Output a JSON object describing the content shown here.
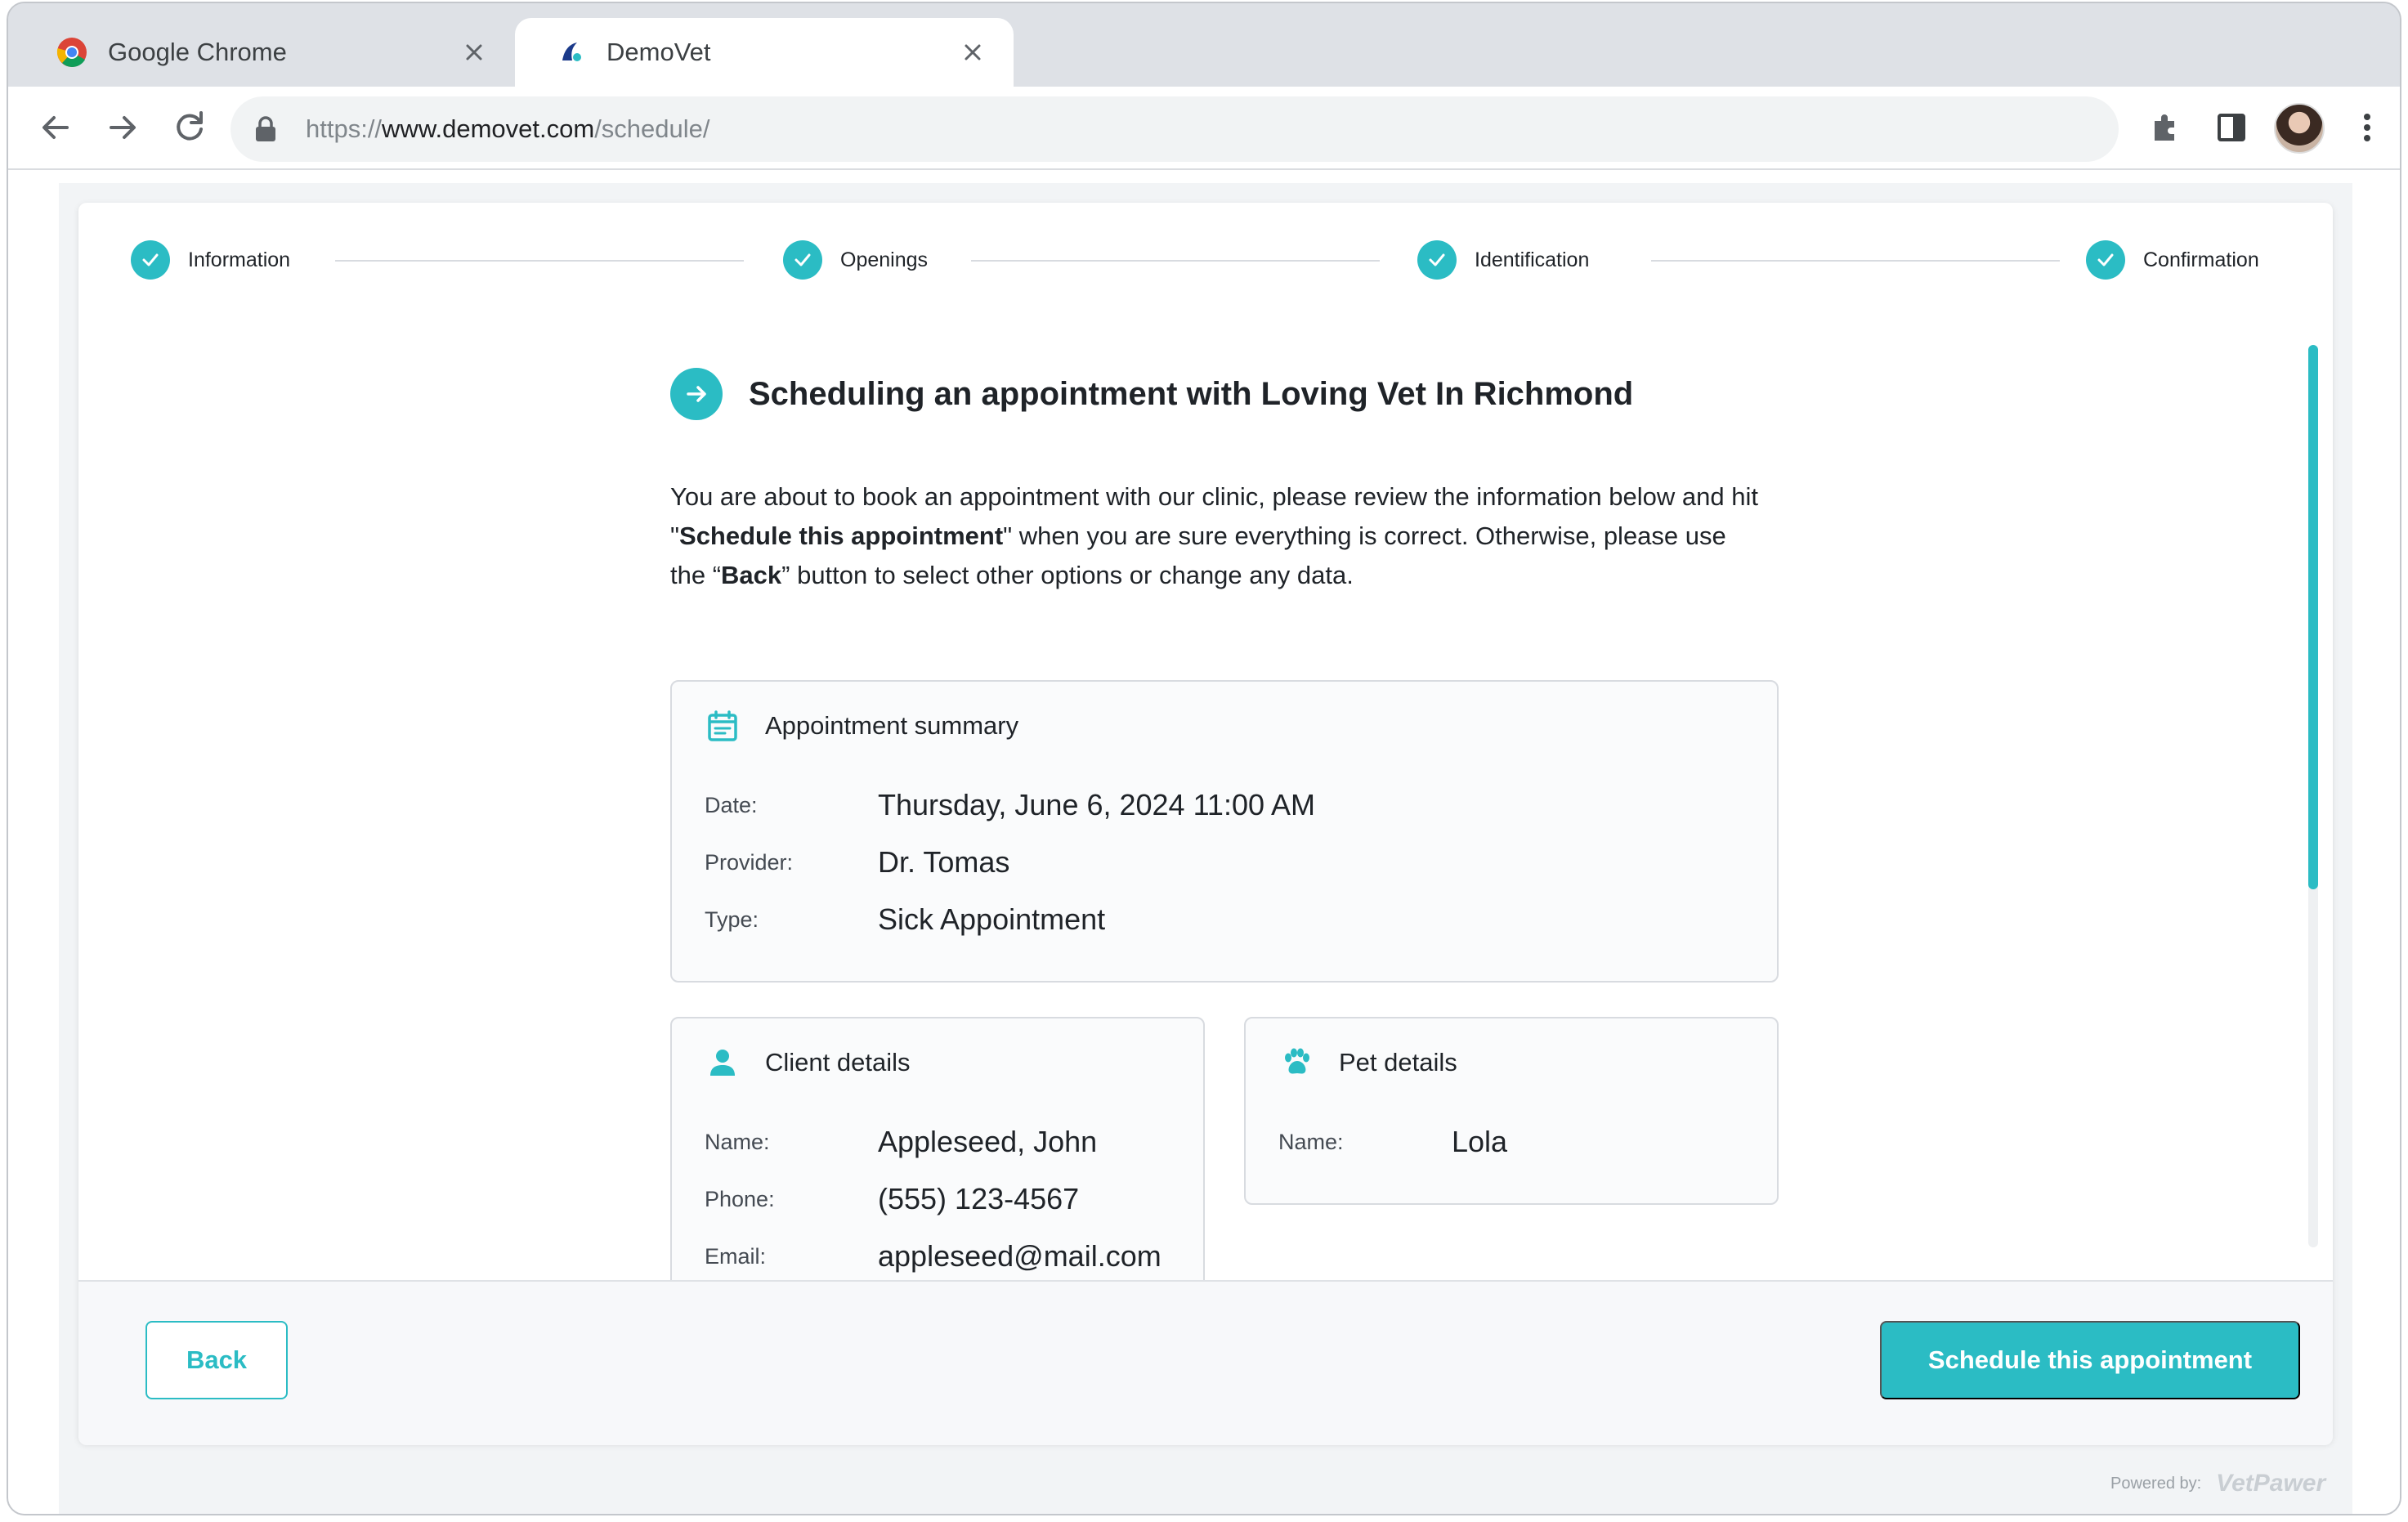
{
  "browser": {
    "tabs": [
      {
        "title": "Google Chrome",
        "active": false
      },
      {
        "title": "DemoVet",
        "active": true
      }
    ],
    "url": {
      "scheme": "https://",
      "host": "www.demovet.com",
      "path": "/schedule/"
    }
  },
  "stepper": {
    "steps": [
      {
        "label": "Information",
        "status": "complete"
      },
      {
        "label": "Openings",
        "status": "complete"
      },
      {
        "label": "Identification",
        "status": "complete"
      },
      {
        "label": "Confirmation",
        "status": "complete"
      }
    ]
  },
  "main": {
    "title": "Scheduling an appointment with Loving Vet In Richmond",
    "intro": {
      "p1": "You are about to book an appointment with our clinic, please review the information below and hit \"",
      "b1": "Schedule this appointment",
      "p2": "\" when you are sure everything is correct. Otherwise, please use the “",
      "b2": "Back",
      "p3": "” button to select other options or change any data."
    }
  },
  "appointment": {
    "heading": "Appointment summary",
    "rows": [
      {
        "label": "Date:",
        "value": "Thursday, June 6, 2024 11:00 AM"
      },
      {
        "label": "Provider:",
        "value": "Dr. Tomas"
      },
      {
        "label": "Type:",
        "value": "Sick Appointment"
      }
    ]
  },
  "client": {
    "heading": "Client details",
    "rows": [
      {
        "label": "Name:",
        "value": "Appleseed, John"
      },
      {
        "label": "Phone:",
        "value": "(555) 123-4567"
      },
      {
        "label": "Email:",
        "value": "appleseed@mail.com"
      }
    ]
  },
  "pet": {
    "heading": "Pet details",
    "rows": [
      {
        "label": "Name:",
        "value": "Lola"
      }
    ]
  },
  "footer": {
    "back_label": "Back",
    "submit_label": "Schedule this appointment",
    "powered_by": "Powered by:",
    "brand": "VetPawer"
  },
  "colors": {
    "accent": "#2bbcc4",
    "text": "#1f2328"
  }
}
